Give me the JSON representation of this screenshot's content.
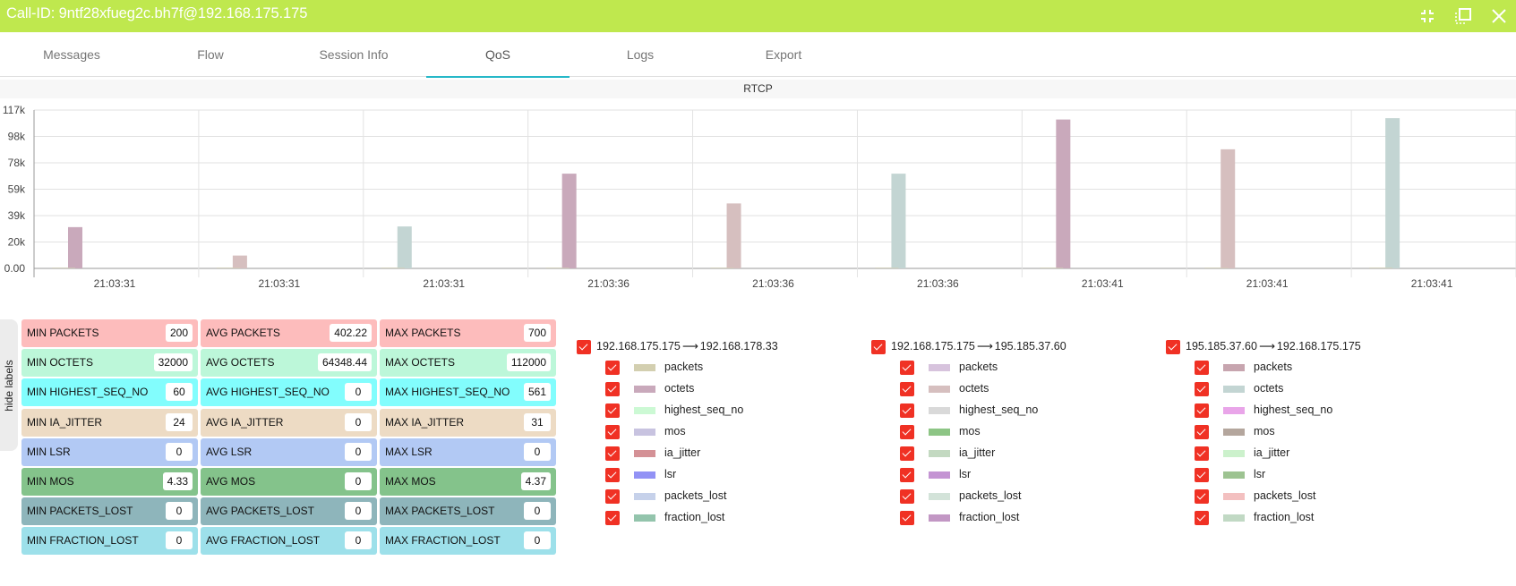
{
  "window": {
    "title": "Call-ID: 9ntf28xfueg2c.bh7f@192.168.175.175",
    "icons": [
      "minimize-icon",
      "restore-icon",
      "close-icon"
    ],
    "accent_color": "#bfe84e"
  },
  "tabs": [
    {
      "label": "Messages",
      "active": false
    },
    {
      "label": "Flow",
      "active": false
    },
    {
      "label": "Session Info",
      "active": false
    },
    {
      "label": "QoS",
      "active": true
    },
    {
      "label": "Logs",
      "active": false
    },
    {
      "label": "Export",
      "active": false
    }
  ],
  "section_title": "RTCP",
  "hide_labels": "hide labels",
  "chart_data": {
    "type": "bar",
    "title": "RTCP",
    "xlabel": "",
    "ylabel": "",
    "ylim": [
      0,
      117000
    ],
    "y_ticks": [
      "0.00",
      "20k",
      "39k",
      "59k",
      "78k",
      "98k",
      "117k"
    ],
    "y_tick_values": [
      0,
      19500,
      39000,
      58500,
      78000,
      97500,
      117000
    ],
    "categories": [
      "21:03:31",
      "21:03:31",
      "21:03:31",
      "21:03:36",
      "21:03:36",
      "21:03:36",
      "21:03:41",
      "21:03:41",
      "21:03:41"
    ],
    "grid": true,
    "series": [
      {
        "name": "192.168.175.175 → 192.168.178.33 octets",
        "color": "#c9a9bb",
        "values": [
          30500,
          0,
          0,
          70000,
          0,
          0,
          110000,
          0,
          0
        ]
      },
      {
        "name": "192.168.175.175 → 195.185.37.60 octets",
        "color": "#d6bfbf",
        "values": [
          0,
          9500,
          0,
          0,
          48000,
          0,
          0,
          88000,
          0
        ]
      },
      {
        "name": "195.185.37.60 → 192.168.175.175 octets",
        "color": "#c3d5d3",
        "values": [
          0,
          0,
          31000,
          0,
          0,
          70000,
          0,
          0,
          111000
        ]
      },
      {
        "name": "packets (all streams)",
        "color": "#d3cfb0",
        "values": [
          200,
          300,
          250,
          400,
          450,
          420,
          600,
          650,
          700
        ]
      }
    ]
  },
  "stats": [
    {
      "color": "#fdbcbc",
      "cells": [
        {
          "label": "MIN PACKETS",
          "value": "200"
        },
        {
          "label": "AVG PACKETS",
          "value": "402.22"
        },
        {
          "label": "MAX PACKETS",
          "value": "700"
        }
      ]
    },
    {
      "color": "#bcf7d9",
      "cells": [
        {
          "label": "MIN OCTETS",
          "value": "32000"
        },
        {
          "label": "AVG OCTETS",
          "value": "64348.44"
        },
        {
          "label": "MAX OCTETS",
          "value": "112000"
        }
      ]
    },
    {
      "color": "#82fdfd",
      "cells": [
        {
          "label": "MIN HIGHEST_SEQ_NO",
          "value": "60"
        },
        {
          "label": "AVG HIGHEST_SEQ_NO",
          "value": "0"
        },
        {
          "label": "MAX HIGHEST_SEQ_NO",
          "value": "561"
        }
      ]
    },
    {
      "color": "#eddbc4",
      "cells": [
        {
          "label": "MIN IA_JITTER",
          "value": "24"
        },
        {
          "label": "AVG IA_JITTER",
          "value": "0"
        },
        {
          "label": "MAX IA_JITTER",
          "value": "31"
        }
      ]
    },
    {
      "color": "#b2c9f4",
      "cells": [
        {
          "label": "MIN LSR",
          "value": "0"
        },
        {
          "label": "AVG LSR",
          "value": "0"
        },
        {
          "label": "MAX LSR",
          "value": "0"
        }
      ]
    },
    {
      "color": "#84c38b",
      "cells": [
        {
          "label": "MIN MOS",
          "value": "4.33"
        },
        {
          "label": "AVG MOS",
          "value": "0"
        },
        {
          "label": "MAX MOS",
          "value": "4.37"
        }
      ]
    },
    {
      "color": "#8eb5bb",
      "cells": [
        {
          "label": "MIN PACKETS_LOST",
          "value": "0"
        },
        {
          "label": "AVG PACKETS_LOST",
          "value": "0"
        },
        {
          "label": "MAX PACKETS_LOST",
          "value": "0"
        }
      ]
    },
    {
      "color": "#9de0ea",
      "cells": [
        {
          "label": "MIN FRACTION_LOST",
          "value": "0"
        },
        {
          "label": "AVG FRACTION_LOST",
          "value": "0"
        },
        {
          "label": "MAX FRACTION_LOST",
          "value": "0"
        }
      ]
    }
  ],
  "streams": [
    {
      "src": "192.168.175.175",
      "dst": "192.168.178.33",
      "arrow": "⟶",
      "checked": true,
      "metrics": [
        {
          "name": "packets",
          "color": "#d3cfb0",
          "checked": true
        },
        {
          "name": "octets",
          "color": "#c9a9bb",
          "checked": true
        },
        {
          "name": "highest_seq_no",
          "color": "#ccf9d4",
          "checked": true
        },
        {
          "name": "mos",
          "color": "#c8c3e0",
          "checked": true
        },
        {
          "name": "ia_jitter",
          "color": "#d49196",
          "checked": true
        },
        {
          "name": "lsr",
          "color": "#9292f5",
          "checked": true
        },
        {
          "name": "packets_lost",
          "color": "#c6d1ea",
          "checked": true
        },
        {
          "name": "fraction_lost",
          "color": "#93c4ac",
          "checked": true
        }
      ]
    },
    {
      "src": "192.168.175.175",
      "dst": "195.185.37.60",
      "arrow": "⟶",
      "checked": true,
      "metrics": [
        {
          "name": "packets",
          "color": "#d7c3dd",
          "checked": true
        },
        {
          "name": "octets",
          "color": "#d6bfbf",
          "checked": true
        },
        {
          "name": "highest_seq_no",
          "color": "#d9d9d9",
          "checked": true
        },
        {
          "name": "mos",
          "color": "#8dc585",
          "checked": true
        },
        {
          "name": "ia_jitter",
          "color": "#c3d9c1",
          "checked": true
        },
        {
          "name": "lsr",
          "color": "#c494d3",
          "checked": true
        },
        {
          "name": "packets_lost",
          "color": "#d3e3d9",
          "checked": true
        },
        {
          "name": "fraction_lost",
          "color": "#c297c4",
          "checked": true
        }
      ]
    },
    {
      "src": "195.185.37.60",
      "dst": "192.168.175.175",
      "arrow": "⟶",
      "checked": true,
      "metrics": [
        {
          "name": "packets",
          "color": "#c7a5af",
          "checked": true
        },
        {
          "name": "octets",
          "color": "#c3d5d3",
          "checked": true
        },
        {
          "name": "highest_seq_no",
          "color": "#e9a5e9",
          "checked": true
        },
        {
          "name": "mos",
          "color": "#b4a69d",
          "checked": true
        },
        {
          "name": "ia_jitter",
          "color": "#ccf1cc",
          "checked": true
        },
        {
          "name": "lsr",
          "color": "#9dc391",
          "checked": true
        },
        {
          "name": "packets_lost",
          "color": "#f3c0c0",
          "checked": true
        },
        {
          "name": "fraction_lost",
          "color": "#c1d9c4",
          "checked": true
        }
      ]
    }
  ]
}
